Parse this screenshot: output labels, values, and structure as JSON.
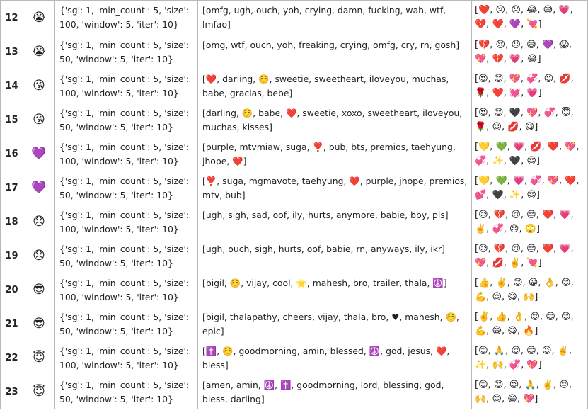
{
  "rows": [
    {
      "num": "12",
      "emoji": "😭",
      "params": "{'sg': 1, 'min_count': 5, 'size': 100, 'window': 5, 'iter': 10}",
      "words": "[omfg, ugh, ouch, yoh, crying, damn, fucking, wah, wtf, lmfao]",
      "similar": "[❤️, 😢, 😞, 😂, 😅, 💗, 💔, ❤️, 💜, 💘]"
    },
    {
      "num": "13",
      "emoji": "😭",
      "params": "{'sg': 1, 'min_count': 5, 'size': 50, 'window': 5, 'iter': 10}",
      "words": "[omg, wtf, ouch, yoh, freaking, crying, omfg, cry, rn, gosh]",
      "similar": "[💔, 😢, 😞, 😅, 💜, 😱, 💖, 💔, 💗, 😂]"
    },
    {
      "num": "14",
      "emoji": "😘",
      "params": "{'sg': 1, 'min_count': 5, 'size': 100, 'window': 5, 'iter': 10}",
      "words": "[❤️, darling, ☺️, sweetie, sweetheart, iloveyou, muchas, babe, gracias, bebe]",
      "similar": "[😍, 😊, 💖, 💞, 😉, 💋, 🌹, ❤️, 💓, 💗]"
    },
    {
      "num": "15",
      "emoji": "😘",
      "params": "{'sg': 1, 'min_count': 5, 'size': 50, 'window': 5, 'iter': 10}",
      "words": "[darling, ☺️, babe, ❤️, sweetie, xoxo, sweetheart, iloveyou, muchas, kisses]",
      "similar": "[😍, 😊, 🖤, 💖, 💞, 😇, 🌹, 😉, 💋, 😋]"
    },
    {
      "num": "16",
      "emoji": "💜",
      "params": "{'sg': 1, 'min_count': 5, 'size': 100, 'window': 5, 'iter': 10}",
      "words": "[purple, mtvmiaw, suga, ❣️, bub, bts, premios, taehyung, jhope, ❤️]",
      "similar": "[💛, 💚, 💗, 💋, ❤️, 💖, 💞, ✨, 🖤, 😍]"
    },
    {
      "num": "17",
      "emoji": "💜",
      "params": "{'sg': 1, 'min_count': 5, 'size': 50, 'window': 5, 'iter': 10}",
      "words": "[❣️, suga, mgmavote, taehyung, ❤️, purple, jhope, premios, mtv, bub]",
      "similar": "[💛, 💚, 💗, 💞, 💖, ❤️, 💕, 🖤, ✨, 😍]"
    },
    {
      "num": "18",
      "emoji": "😞",
      "params": "{'sg': 1, 'min_count': 5, 'size': 100, 'window': 5, 'iter': 10}",
      "words": "[ugh, sigh, sad, oof, ily, hurts, anymore, babie, bby, pls]",
      "similar": "[😥, 💔, 😢, 😔, ❤️, 💗, ✌️, 💞, 😞, 🙄]"
    },
    {
      "num": "19",
      "emoji": "😞",
      "params": "{'sg': 1, 'min_count': 5, 'size': 50, 'window': 5, 'iter': 10}",
      "words": "[ugh, ouch, sigh, hurts, oof, babie, rn, anyways, ily, ikr]",
      "similar": "[😥, 💔, 😢, 😔, ❤️, 💗, 💖, 💋, ✌️, 💘]"
    },
    {
      "num": "20",
      "emoji": "😎",
      "params": "{'sg': 1, 'min_count': 5, 'size': 100, 'window': 5, 'iter': 10}",
      "words": "[bigil, ☺️, vijay, cool, 🌟, mahesh, bro, trailer, thala, ☮️]",
      "similar": "[👍, ✌️, 😊, 😁, 👌, 😊, 💪, 😌, 😋, 🙌]"
    },
    {
      "num": "21",
      "emoji": "😎",
      "params": "{'sg': 1, 'min_count': 5, 'size': 50, 'window': 5, 'iter': 10}",
      "words": "[bigil, thalapathy, cheers, vijay, thala, bro, ♥, mahesh, ☺️, epic]",
      "similar": "[✌️, 👍, 👌, 😌, 😊, 😊, 💪, 😁, 😋, 🔥]"
    },
    {
      "num": "22",
      "emoji": "😇",
      "params": "{'sg': 1, 'min_count': 5, 'size': 100, 'window': 5, 'iter': 10}",
      "words": "[✝️, ☺️, goodmorning, amin, blessed, ☮️, god, jesus, ❤️, bless]",
      "similar": "[😊, 🙏, 😌, 😊, 😉, ✌️, ✨, 🙌, 💞, 💖]"
    },
    {
      "num": "23",
      "emoji": "😇",
      "params": "{'sg': 1, 'min_count': 5, 'size': 50, 'window': 5, 'iter': 10}",
      "words": "[amen, amin, ☮️, ✝️, goodmorning, lord, blessing, god, bless, darling]",
      "similar": "[😊, 😌, 😉, 🙏, ✌️, 😔, 🙌, 😊, 😁, 💖]"
    }
  ]
}
